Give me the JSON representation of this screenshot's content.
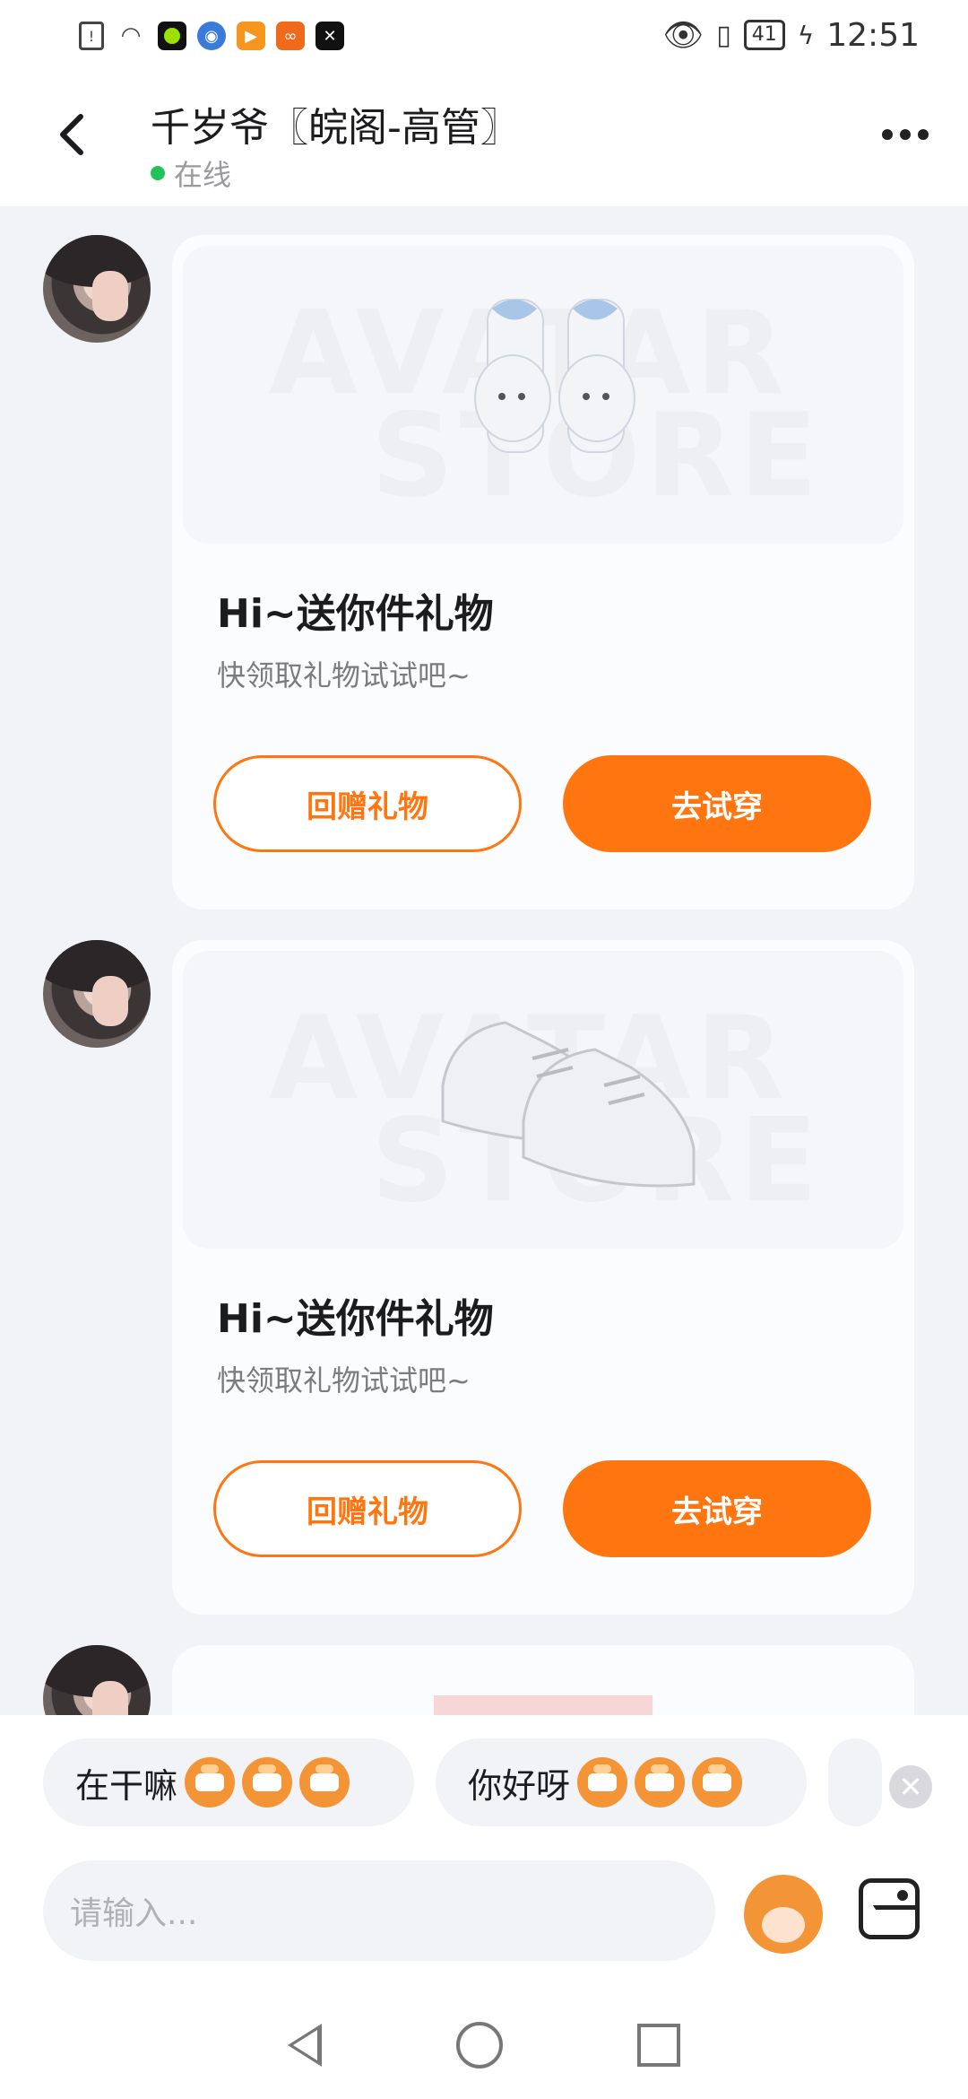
{
  "status_bar": {
    "time": "12:51",
    "battery": "41",
    "icons": [
      "alert-icon",
      "wifi-icon",
      "app-icon-green",
      "app-icon-blue",
      "app-icon-video",
      "app-icon-orange",
      "app-icon-capcut",
      "eye-icon",
      "vibrate-icon",
      "charging-icon"
    ]
  },
  "header": {
    "title": "千岁爷〖皖阁-高管〗",
    "status": "在线"
  },
  "messages": [
    {
      "title": "Hi~送你件礼物",
      "subtitle": "快领取礼物试试吧~",
      "watermark_top": "AVATAR",
      "watermark_bottom": "STORE",
      "item": "bow-socks",
      "btn_return": "回赠礼物",
      "btn_try": "去试穿"
    },
    {
      "title": "Hi~送你件礼物",
      "subtitle": "快领取礼物试试吧~",
      "watermark_top": "AVATAR",
      "watermark_bottom": "STORE",
      "item": "white-sneakers",
      "btn_return": "回赠礼物",
      "btn_try": "去试穿"
    }
  ],
  "quick_replies": [
    {
      "text": "在干嘛",
      "emoji_count": 3
    },
    {
      "text": "你好呀",
      "emoji_count": 3
    }
  ],
  "input": {
    "placeholder": "请输入..."
  },
  "colors": {
    "accent": "#ff7611",
    "online": "#1fc35a",
    "background": "#f1f3f7"
  }
}
